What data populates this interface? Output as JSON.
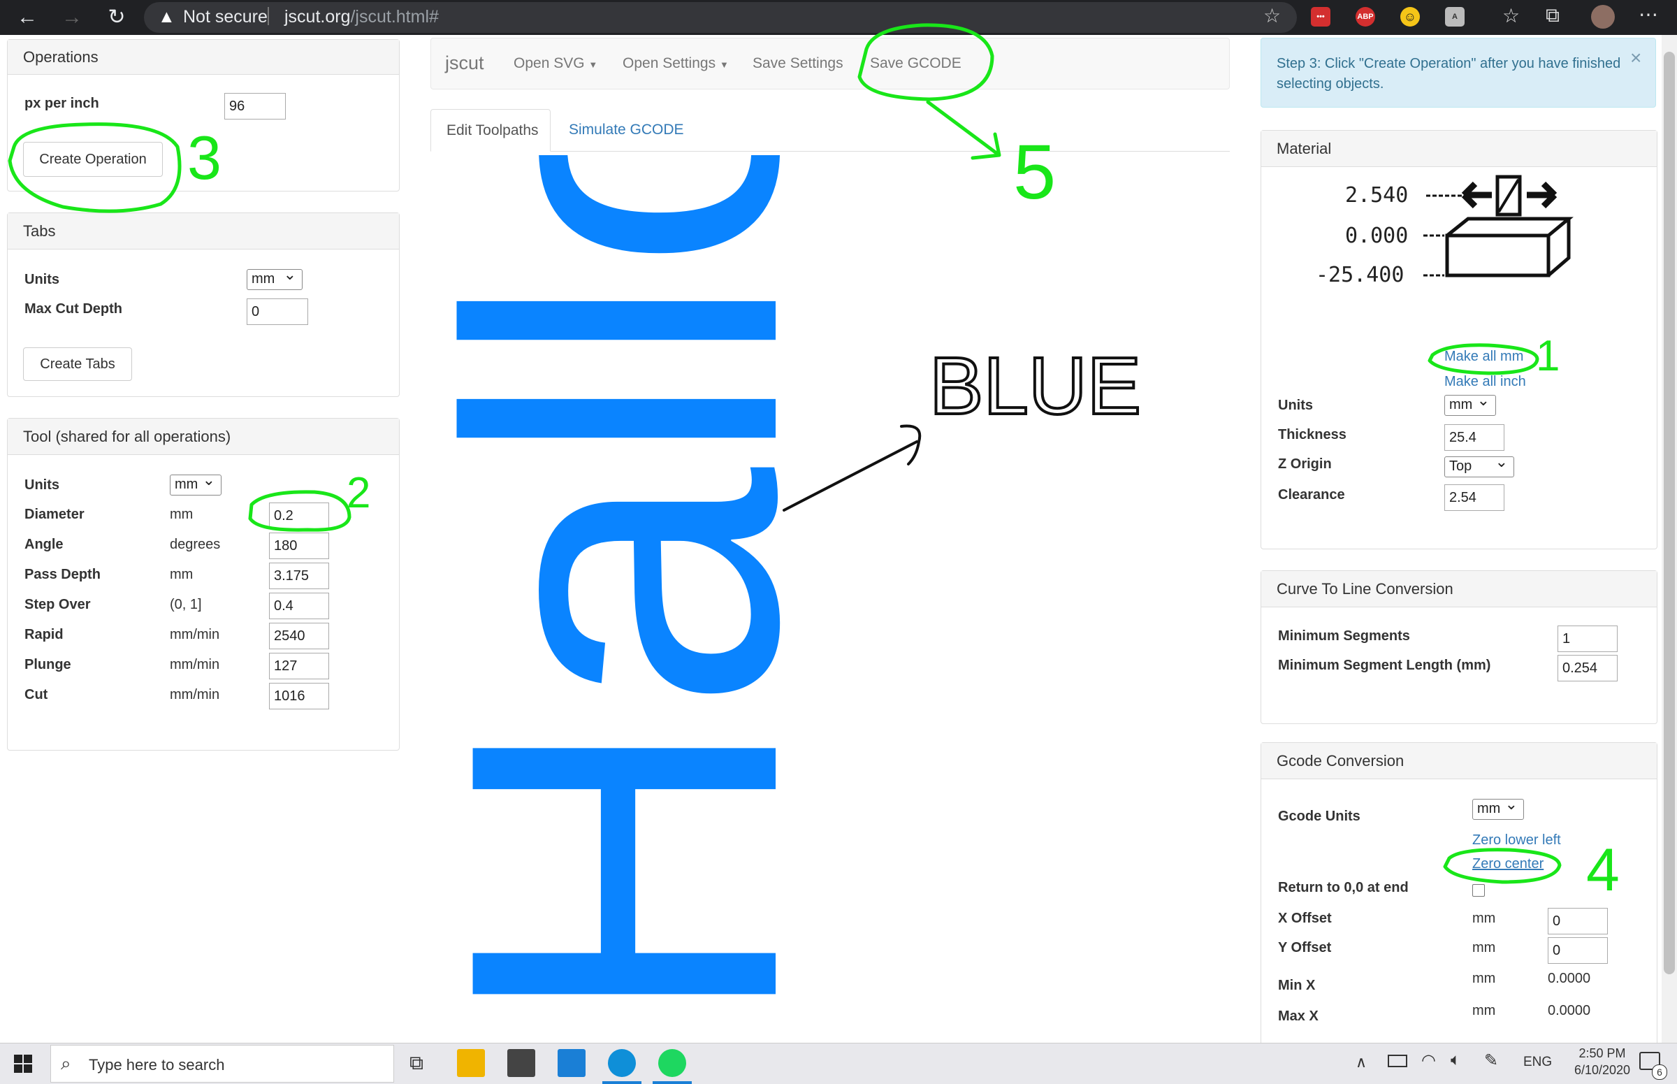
{
  "browser": {
    "security": "Not secure",
    "url_host": "jscut.org",
    "url_path": "/jscut.html#"
  },
  "operations": {
    "title": "Operations",
    "px_per_inch_label": "px per inch",
    "px_per_inch_value": "96",
    "create_button": "Create Operation"
  },
  "tabs_panel": {
    "title": "Tabs",
    "units_label": "Units",
    "units_value": "mm",
    "max_depth_label": "Max Cut Depth",
    "max_depth_value": "0",
    "create_button": "Create Tabs"
  },
  "tool": {
    "title": "Tool (shared for all operations)",
    "units_label": "Units",
    "units_value": "mm",
    "rows": [
      {
        "label": "Diameter",
        "unit": "mm",
        "value": "0.2"
      },
      {
        "label": "Angle",
        "unit": "degrees",
        "value": "180"
      },
      {
        "label": "Pass Depth",
        "unit": "mm",
        "value": "3.175"
      },
      {
        "label": "Step Over",
        "unit": "(0, 1]",
        "value": "0.4"
      },
      {
        "label": "Rapid",
        "unit": "mm/min",
        "value": "2540"
      },
      {
        "label": "Plunge",
        "unit": "mm/min",
        "value": "127"
      },
      {
        "label": "Cut",
        "unit": "mm/min",
        "value": "1016"
      }
    ]
  },
  "navbar": {
    "brand": "jscut",
    "open_svg": "Open SVG",
    "open_settings": "Open Settings",
    "save_settings": "Save Settings",
    "save_gcode": "Save GCODE"
  },
  "main_tabs": {
    "edit": "Edit Toolpaths",
    "simulate": "Simulate GCODE"
  },
  "canvas": {
    "svg_text": "Hallo",
    "annotation_blue": "BLUE",
    "text_color": "#0a84ff"
  },
  "alert": {
    "text": "Step 3: Click \"Create Operation\" after you have finished selecting objects.",
    "close": "×"
  },
  "material": {
    "title": "Material",
    "diagram_values": [
      "2.540",
      "0.000",
      "-25.400"
    ],
    "make_all_mm": "Make all mm",
    "make_all_inch": "Make all inch",
    "units_label": "Units",
    "units_value": "mm",
    "thickness_label": "Thickness",
    "thickness_value": "25.4",
    "zorigin_label": "Z Origin",
    "zorigin_value": "Top",
    "clearance_label": "Clearance",
    "clearance_value": "2.54"
  },
  "curve": {
    "title": "Curve To Line Conversion",
    "min_segments_label": "Minimum Segments",
    "min_segments_value": "1",
    "min_length_label": "Minimum Segment Length (mm)",
    "min_length_value": "0.254"
  },
  "gcode": {
    "title": "Gcode Conversion",
    "units_label": "Gcode Units",
    "units_value": "mm",
    "zero_lower_left": "Zero lower left",
    "zero_center": "Zero center",
    "return_label": "Return to 0,0 at end",
    "xoffset_label": "X Offset",
    "xoffset_unit": "mm",
    "xoffset_value": "0",
    "yoffset_label": "Y Offset",
    "yoffset_unit": "mm",
    "yoffset_value": "0",
    "minx_label": "Min X",
    "minx_unit": "mm",
    "minx_value": "0.0000",
    "maxx_label": "Max X",
    "maxx_unit": "mm",
    "maxx_value": "0.0000"
  },
  "annotations": [
    "3",
    "2",
    "5",
    "1",
    "4"
  ],
  "taskbar": {
    "search_placeholder": "Type here to search",
    "lang": "ENG",
    "time": "2:50 PM",
    "date": "6/10/2020",
    "notif_count": "6"
  }
}
